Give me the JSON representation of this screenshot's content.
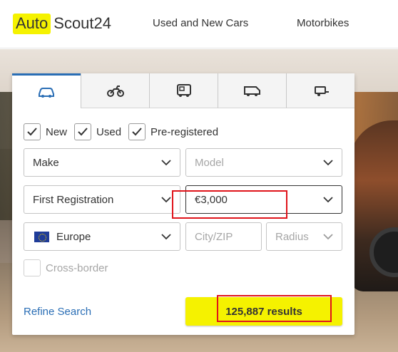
{
  "header": {
    "logo": {
      "part1": "Auto",
      "part2": "Scout24"
    },
    "nav": {
      "used_new": "Used and New Cars",
      "motorbikes": "Motorbikes"
    }
  },
  "tabs": [
    {
      "icon": "car-icon",
      "active": true
    },
    {
      "icon": "motorbike-icon",
      "active": false
    },
    {
      "icon": "camper-icon",
      "active": false
    },
    {
      "icon": "van-icon",
      "active": false
    },
    {
      "icon": "trailer-icon",
      "active": false
    }
  ],
  "conditions": {
    "new": {
      "label": "New",
      "checked": true
    },
    "used": {
      "label": "Used",
      "checked": true
    },
    "preregistered": {
      "label": "Pre-registered",
      "checked": true
    }
  },
  "fields": {
    "make": "Make",
    "model_placeholder": "Model",
    "first_registration": "First Registration",
    "price": "€3,000",
    "country": "Europe",
    "city_placeholder": "City/ZIP",
    "radius_placeholder": "Radius"
  },
  "cross_border": {
    "label": "Cross-border",
    "checked": false
  },
  "actions": {
    "refine": "Refine Search",
    "results": "125,887 results"
  },
  "colors": {
    "brand_yellow": "#f5f200",
    "accent_blue": "#2a6eb5",
    "annotation_red": "#e0141b"
  }
}
